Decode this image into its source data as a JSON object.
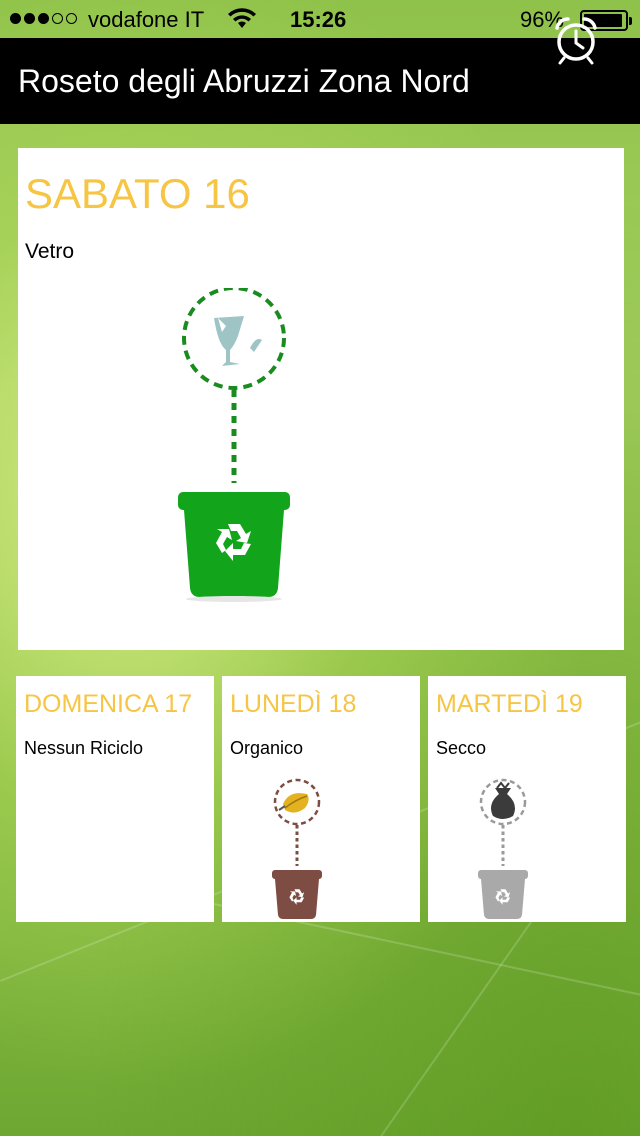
{
  "status_bar": {
    "signal_dots_filled": 3,
    "signal_dots_total": 5,
    "carrier": "vodafone IT",
    "time": "15:26",
    "battery_percent": "96%",
    "battery_level": 0.96
  },
  "header": {
    "title": "Roseto degli Abruzzi Zona Nord",
    "alarm_icon": "alarm-clock-icon"
  },
  "today": {
    "day": "SABATO 16",
    "waste_type": "Vetro",
    "icon": "glass-bin-icon",
    "bin_color": "#12a41a"
  },
  "upcoming": [
    {
      "day": "DOMENICA 17",
      "waste_type": "Nessun Riciclo",
      "icon": null,
      "bin_color": null
    },
    {
      "day": "LUNEDÌ 18",
      "waste_type": "Organico",
      "icon": "organic-bin-icon",
      "bin_color": "#7d4c42"
    },
    {
      "day": "MARTEDÌ 19",
      "waste_type": "Secco",
      "icon": "dry-waste-bin-icon",
      "bin_color": "#a9a9a9"
    }
  ],
  "colors": {
    "day_label": "#f6c544",
    "navbar_bg": "#000000",
    "organic_dashed": "#7d4c42",
    "glass_dashed": "#12a41a",
    "dry_dashed": "#9a9a9a"
  }
}
